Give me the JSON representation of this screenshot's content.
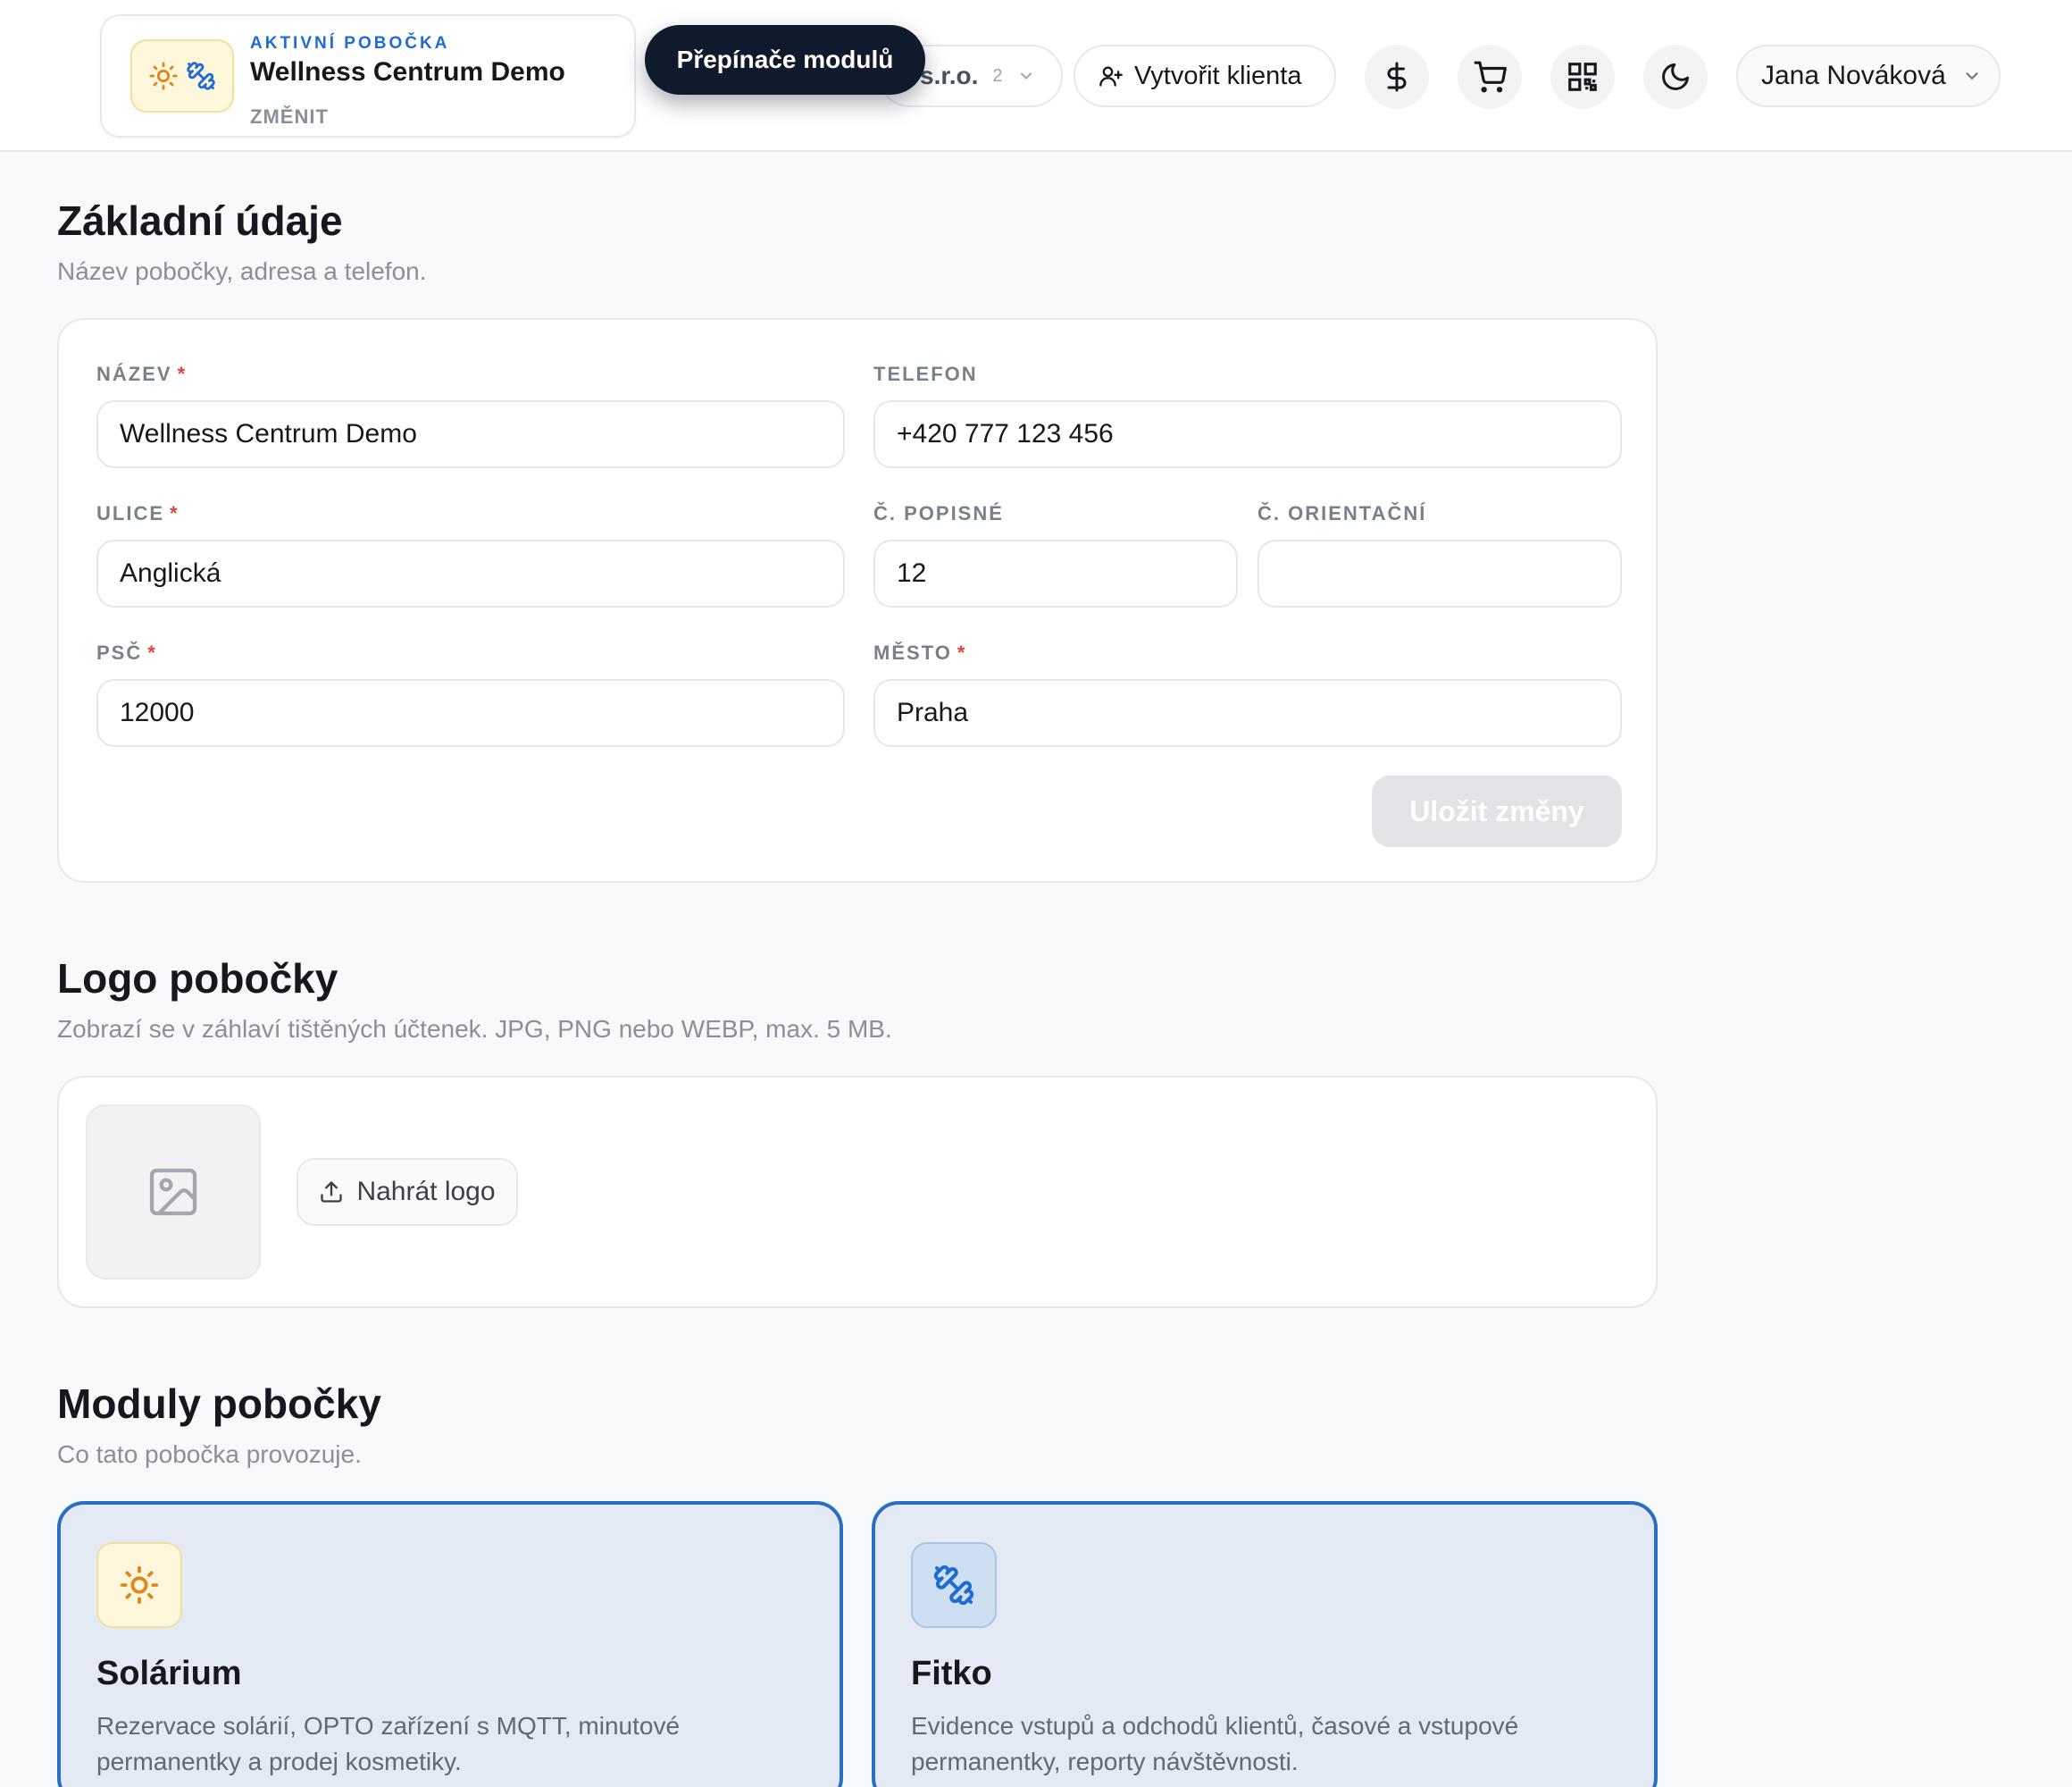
{
  "header": {
    "branch": {
      "kicker": "AKTIVNÍ POBOČKA",
      "name": "Wellness Centrum Demo",
      "change": "ZMĚNIT"
    },
    "company": {
      "name_fragment": "s.r.o.",
      "count": "2"
    },
    "create_client": "Vytvořit klienta",
    "icons": [
      "dollar-icon",
      "cart-icon",
      "qr-code-icon",
      "moon-icon"
    ],
    "user": "Jana Nováková",
    "tooltip": "Přepínače modulů"
  },
  "basic": {
    "title": "Základní údaje",
    "subtitle": "Název pobočky, adresa a telefon.",
    "fields": {
      "name": {
        "label": "NÁZEV",
        "required": "*",
        "value": "Wellness Centrum Demo"
      },
      "phone": {
        "label": "TELEFON",
        "value": "+420 777 123 456"
      },
      "street": {
        "label": "ULICE",
        "required": "*",
        "value": "Anglická"
      },
      "house_no": {
        "label": "Č. POPISNÉ",
        "value": "12"
      },
      "orient_no": {
        "label": "Č. ORIENTAČNÍ",
        "value": ""
      },
      "zip": {
        "label": "PSČ",
        "required": "*",
        "value": "12000"
      },
      "city": {
        "label": "MĚSTO",
        "required": "*",
        "value": "Praha"
      }
    },
    "save": "Uložit změny"
  },
  "logo": {
    "title": "Logo pobočky",
    "subtitle": "Zobrazí se v záhlaví tištěných účtenek. JPG, PNG nebo WEBP, max. 5 MB.",
    "upload": "Nahrát logo"
  },
  "modules": {
    "title": "Moduly pobočky",
    "subtitle": "Co tato pobočka provozuje.",
    "items": [
      {
        "name": "Solárium",
        "desc": "Rezervace solárií, OPTO zařízení s MQTT, minutové permanentky a prodej kosmetiky.",
        "icon": "sun-icon"
      },
      {
        "name": "Fitko",
        "desc": "Evidence vstupů a odchodů klientů, časové a vstupové permanentky, reporty návštěvnosti.",
        "icon": "dumbbell-icon"
      }
    ]
  },
  "colors": {
    "accent": "#2a6dc4",
    "kicker": "#1f6bd4",
    "sun": "#e0861a",
    "required": "#e0443e",
    "tooltip_bg": "#111a2c"
  }
}
